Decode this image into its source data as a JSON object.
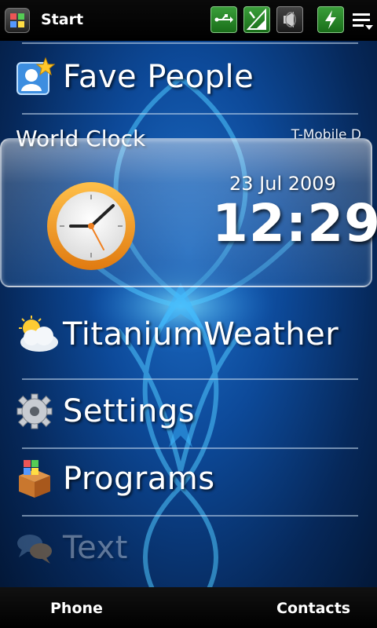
{
  "status_bar": {
    "start_label": "Start",
    "icons": [
      "windows-start-icon",
      "usb-sync-icon",
      "signal-strength-icon",
      "speaker-icon",
      "battery-charging-icon",
      "menu-icon"
    ]
  },
  "menu": {
    "fave_people": "Fave People",
    "world_clock": {
      "title": "World Clock",
      "carrier": "T-Mobile D",
      "date": "23 Jul 2009",
      "time": "12:29"
    },
    "titanium_weather": "TitaniumWeather",
    "settings": "Settings",
    "programs": "Programs",
    "text": "Text"
  },
  "soft_keys": {
    "left": "Phone",
    "right": "Contacts"
  },
  "colors": {
    "background": "#0d4a9a",
    "accent_green": "#2a8e2a",
    "clock_orange": "#f29a1e"
  }
}
